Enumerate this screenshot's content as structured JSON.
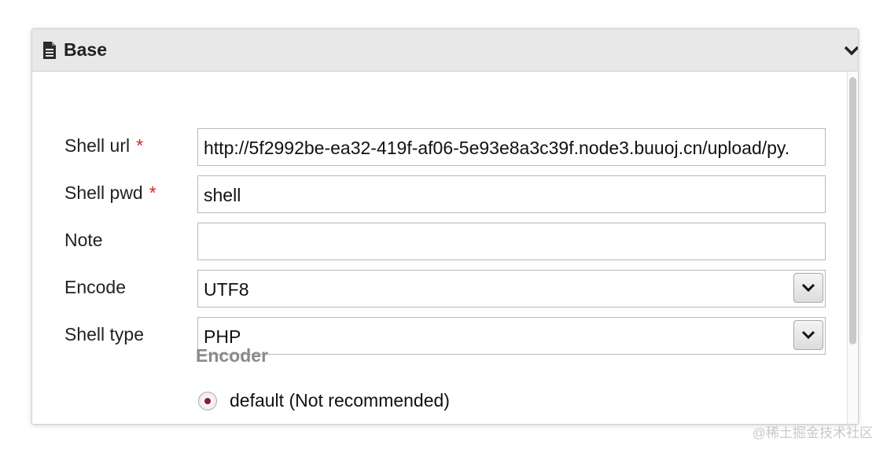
{
  "panel": {
    "title": "Base",
    "icon": "document-icon",
    "collapse_icon": "chevron-down-icon"
  },
  "form": {
    "shell_url": {
      "label": "Shell url",
      "required_mark": "*",
      "value": "http://5f2992be-ea32-419f-af06-5e93e8a3c39f.node3.buuoj.cn/upload/py."
    },
    "shell_pwd": {
      "label": "Shell pwd",
      "required_mark": "*",
      "value": "shell"
    },
    "note": {
      "label": "Note",
      "value": ""
    },
    "encode": {
      "label": "Encode",
      "value": "UTF8"
    },
    "shell_type": {
      "label": "Shell type",
      "value": "PHP"
    }
  },
  "encoder": {
    "title": "Encoder",
    "options": [
      {
        "label": "default (Not recommended)",
        "selected": true
      }
    ]
  },
  "watermark": "@稀土掘金技术社区",
  "colors": {
    "required": "#d9232d",
    "header_bg": "#e8e8e8",
    "encoder_title": "#8a8a8a"
  }
}
